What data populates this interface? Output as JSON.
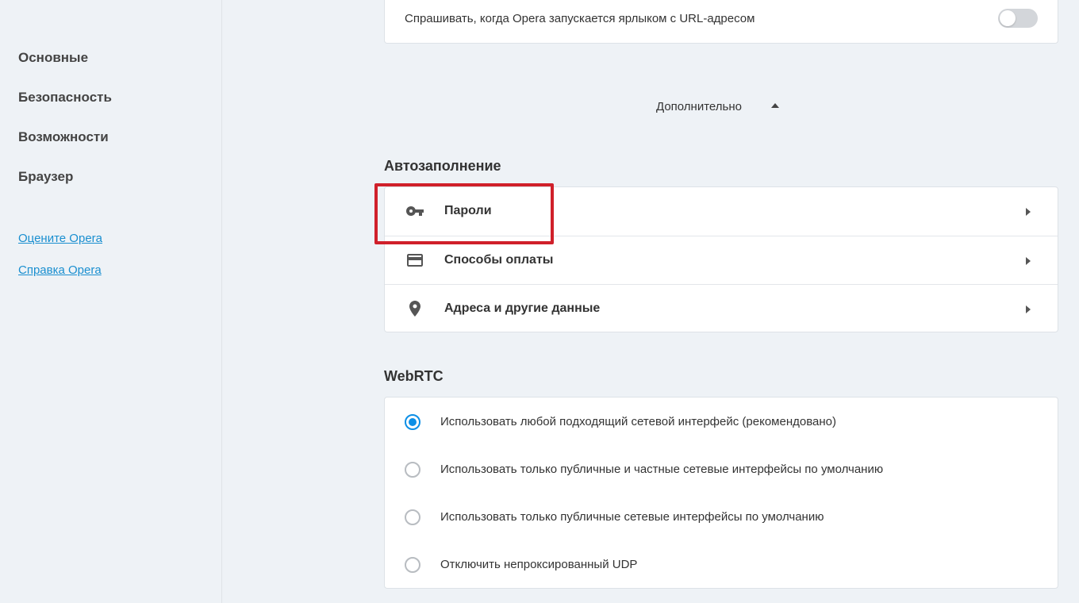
{
  "sidebar": {
    "items": [
      {
        "label": "Основные"
      },
      {
        "label": "Безопасность"
      },
      {
        "label": "Возможности"
      },
      {
        "label": "Браузер"
      }
    ],
    "links": [
      {
        "label": "Оцените Opera"
      },
      {
        "label": "Справка Opera"
      }
    ]
  },
  "startup": {
    "ask_label": "Спрашивать, когда Opera запускается ярлыком с URL-адресом",
    "toggle_on": false
  },
  "advanced": {
    "label": "Дополнительно"
  },
  "autofill": {
    "title": "Автозаполнение",
    "rows": [
      {
        "label": "Пароли",
        "icon": "key-icon"
      },
      {
        "label": "Способы оплаты",
        "icon": "credit-card-icon"
      },
      {
        "label": "Адреса и другие данные",
        "icon": "location-pin-icon"
      }
    ]
  },
  "webrtc": {
    "title": "WebRTC",
    "options": [
      {
        "label": "Использовать любой подходящий сетевой интерфейс (рекомендовано)",
        "checked": true
      },
      {
        "label": "Использовать только публичные и частные сетевые интерфейсы по умолчанию",
        "checked": false
      },
      {
        "label": "Использовать только публичные сетевые интерфейсы по умолчанию",
        "checked": false
      },
      {
        "label": "Отключить непроксированный UDP",
        "checked": false
      }
    ]
  },
  "colors": {
    "accent": "#0d8fe6",
    "highlight": "#d0202a",
    "link": "#1a8fd0"
  }
}
